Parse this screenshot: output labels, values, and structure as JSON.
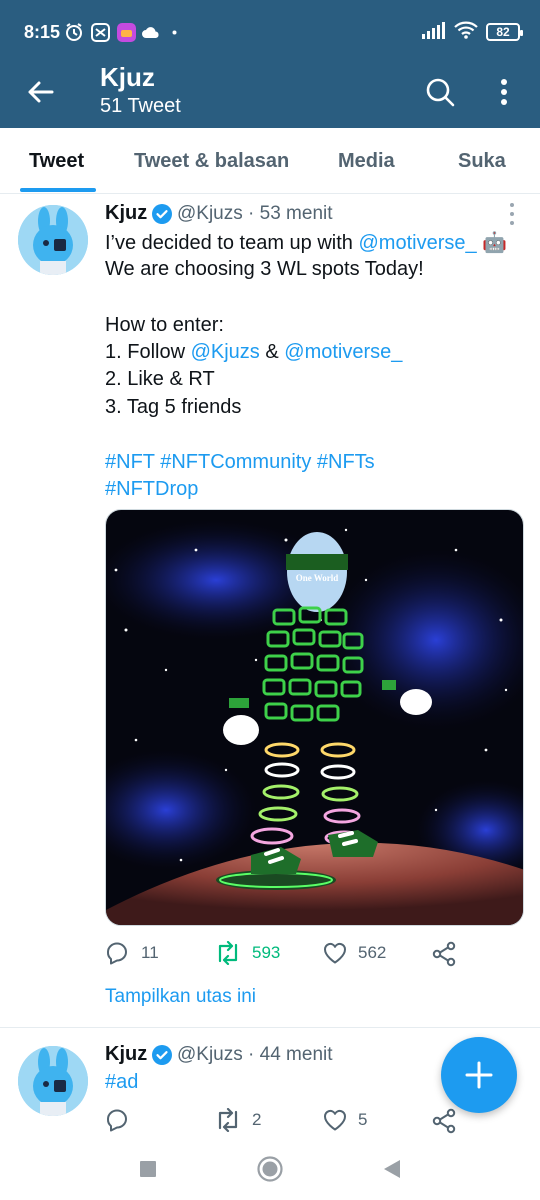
{
  "status_bar": {
    "time": "8:15",
    "battery": "82",
    "icons": [
      "alarm-icon",
      "capcut-icon",
      "app-icon",
      "cloud-icon",
      "dot-icon",
      "signal-icon",
      "wifi-icon",
      "battery-icon"
    ]
  },
  "header": {
    "title": "Kjuz",
    "subtitle": "51 Tweet",
    "back_icon": "arrow-left-icon",
    "search_icon": "search-icon",
    "more_icon": "more-vertical-icon",
    "color": "#2a5d80"
  },
  "tabs": [
    {
      "label": "Tweet",
      "active": true
    },
    {
      "label": "Tweet & balasan",
      "active": false
    },
    {
      "label": "Media",
      "active": false
    },
    {
      "label": "Suka",
      "active": false
    }
  ],
  "accent_color": "#1d9bf0",
  "retweet_color": "#00ba7c",
  "tweets": [
    {
      "name": "Kjuz",
      "handle": "@Kjuzs · 53 menit",
      "lines": {
        "l1_text": "I’ve decided to team up with ",
        "l1_link": "@motiverse_",
        "l1_emoji": " 🤖",
        "l2": "We are choosing 3 WL spots Today!",
        "l3": " How to enter:",
        "l4_pre": "1. Follow ",
        "l4_link1": "@Kjuzs",
        "l4_mid": " & ",
        "l4_link2": "@motiverse_",
        "l5": " 2. Like & RT",
        "l6": "3. Tag 5 friends",
        "l7": "#NFT #NFTCommunity #NFTs",
        "l8": "#NFTDrop"
      },
      "media_text": "One World",
      "replies": "11",
      "retweets": "593",
      "likes": "562",
      "thread_link": "Tampilkan utas ini"
    },
    {
      "name": "Kjuz",
      "handle": "@Kjuzs · 44 menit",
      "text": "#ad",
      "replies": "",
      "retweets": "2",
      "likes": "5"
    }
  ],
  "fab_icon": "plus-icon",
  "navbar": [
    "recents-icon",
    "home-icon",
    "back-triangle-icon"
  ]
}
